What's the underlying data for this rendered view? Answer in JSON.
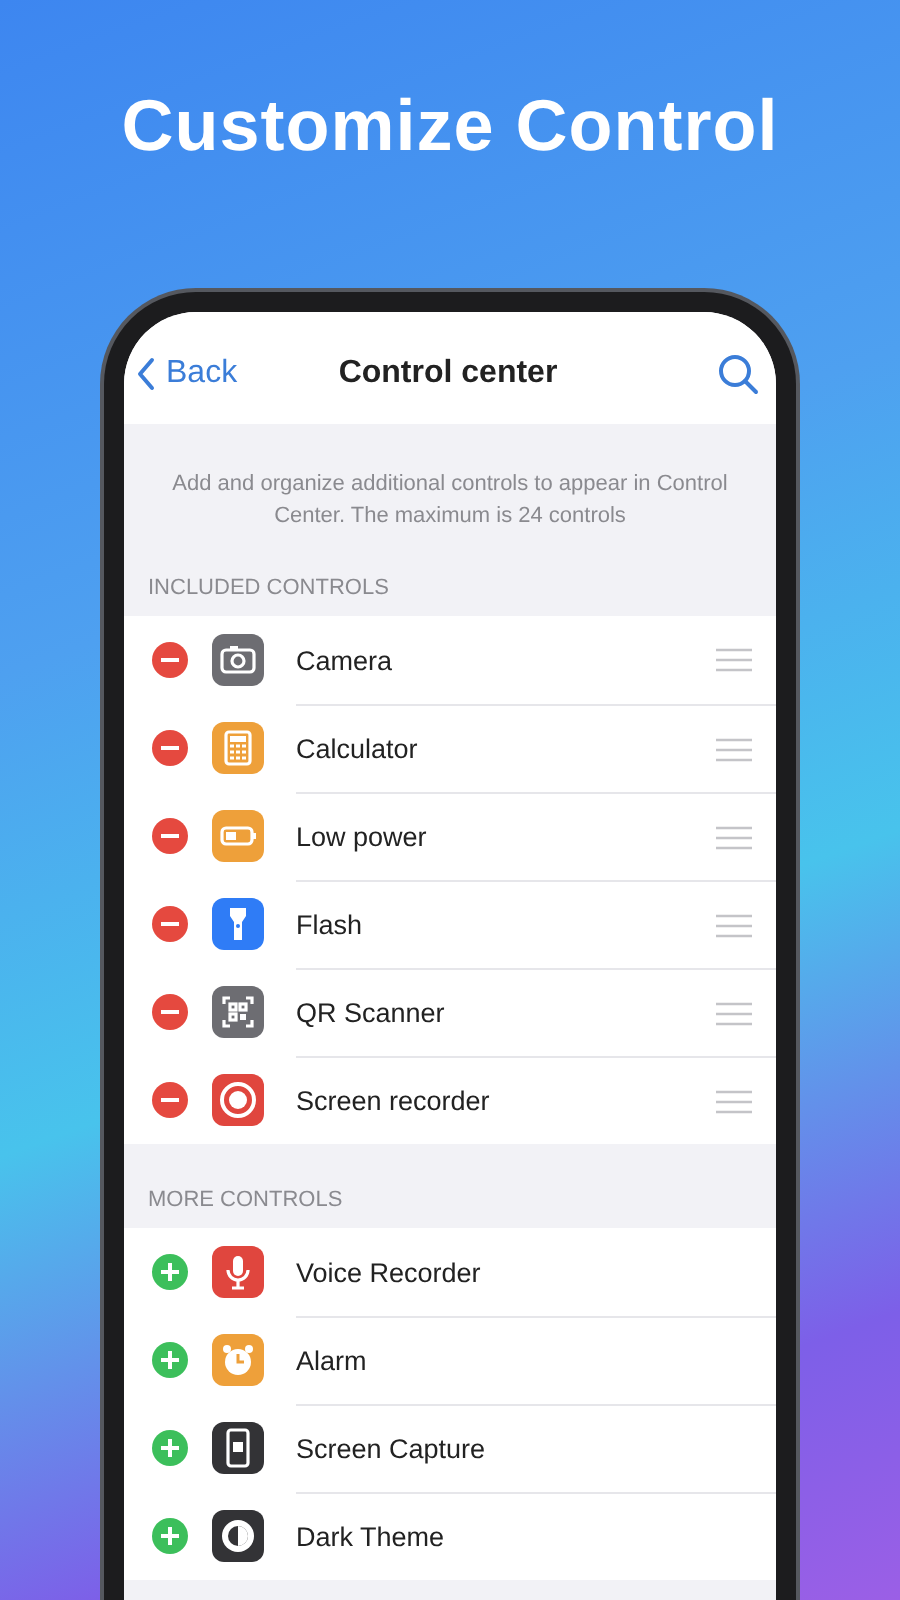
{
  "headline": "Customize Control",
  "nav": {
    "back": "Back",
    "title": "Control center"
  },
  "description": "Add and organize additional controls to appear in Control Center. The maximum is 24 controls",
  "sections": [
    {
      "header": "INCLUDED CONTROLS",
      "kind": "remove",
      "items": [
        {
          "label": "Camera",
          "kind": "camera",
          "color": "#6d6d72"
        },
        {
          "label": "Calculator",
          "kind": "calculator",
          "color": "#eea03a"
        },
        {
          "label": "Low power",
          "kind": "battery",
          "color": "#eea03a"
        },
        {
          "label": "Flash",
          "kind": "flashlight",
          "color": "#2f7cf6"
        },
        {
          "label": "QR Scanner",
          "kind": "qr",
          "color": "#6d6d72"
        },
        {
          "label": "Screen recorder",
          "kind": "record",
          "color": "#e0463e"
        }
      ]
    },
    {
      "header": "MORE CONTROLS",
      "kind": "add",
      "items": [
        {
          "label": "Voice Recorder",
          "kind": "mic",
          "color": "#e0463e"
        },
        {
          "label": "Alarm",
          "kind": "alarm",
          "color": "#eea03a"
        },
        {
          "label": "Screen Capture",
          "kind": "phone",
          "color": "#333336"
        },
        {
          "label": "Dark Theme",
          "kind": "theme",
          "color": "#333336"
        }
      ]
    }
  ]
}
